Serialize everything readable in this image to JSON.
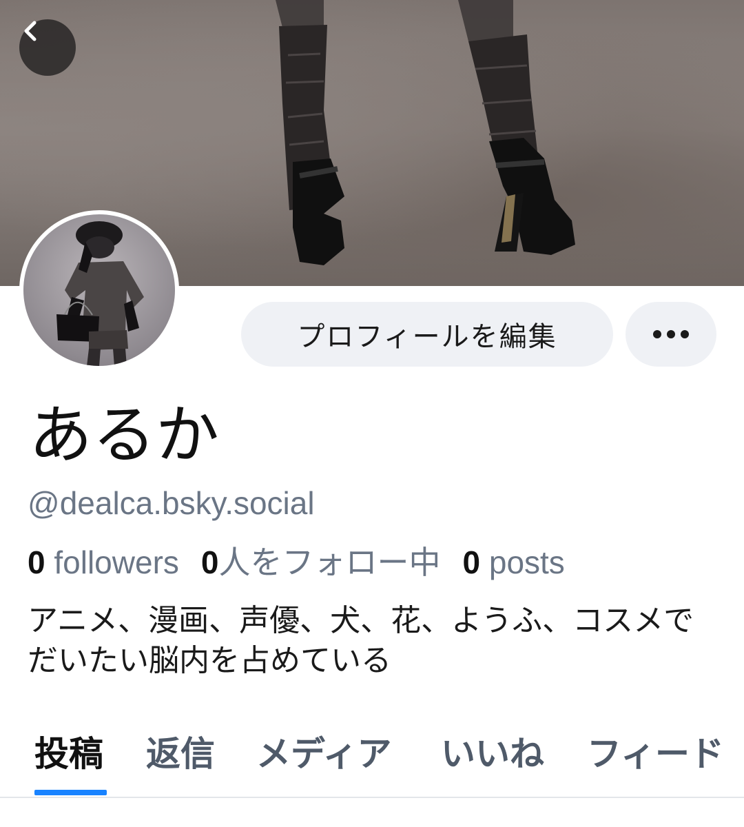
{
  "profile": {
    "display_name": "あるか",
    "handle": "@dealca.bsky.social",
    "bio": "アニメ、漫画、声優、犬、花、ようふ、コスメでだいたい脳内を占めている"
  },
  "stats": {
    "followers_count": "0",
    "followers_label": " followers",
    "following_count": "0",
    "following_label": "人をフォロー中",
    "posts_count": "0",
    "posts_label": " posts"
  },
  "actions": {
    "edit_profile_label": "プロフィールを編集",
    "more_icon": "more-dots-icon",
    "back_icon": "chevron-left-icon"
  },
  "tabs": [
    {
      "label": "投稿",
      "active": true
    },
    {
      "label": "返信",
      "active": false
    },
    {
      "label": "メディア",
      "active": false
    },
    {
      "label": "いいね",
      "active": false
    },
    {
      "label": "フィード",
      "active": false
    }
  ],
  "colors": {
    "accent": "#1983ff",
    "muted_text": "#6a7585",
    "button_bg": "#eff1f5"
  }
}
